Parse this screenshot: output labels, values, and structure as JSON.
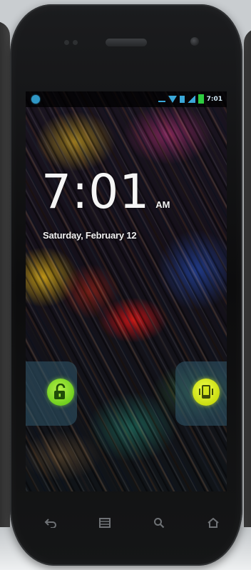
{
  "status_bar": {
    "time": "7:01",
    "icons": [
      "app-notification-icon",
      "usb-icon",
      "wifi-icon",
      "sim-icon",
      "signal-icon",
      "battery-icon"
    ],
    "accent_color": "#3aa7d8",
    "battery_color": "#2ecc40"
  },
  "lock_screen": {
    "clock_time": "7:01",
    "clock_ampm": "AM",
    "date": "Saturday, February 12",
    "unlock_icon": "unlock-icon",
    "sound_icon": "sound-toggle-icon",
    "unlock_color": "#8ee630",
    "sound_color": "#d9ea1e"
  },
  "navigation_keys": [
    "back-icon",
    "menu-icon",
    "search-icon",
    "home-icon"
  ]
}
